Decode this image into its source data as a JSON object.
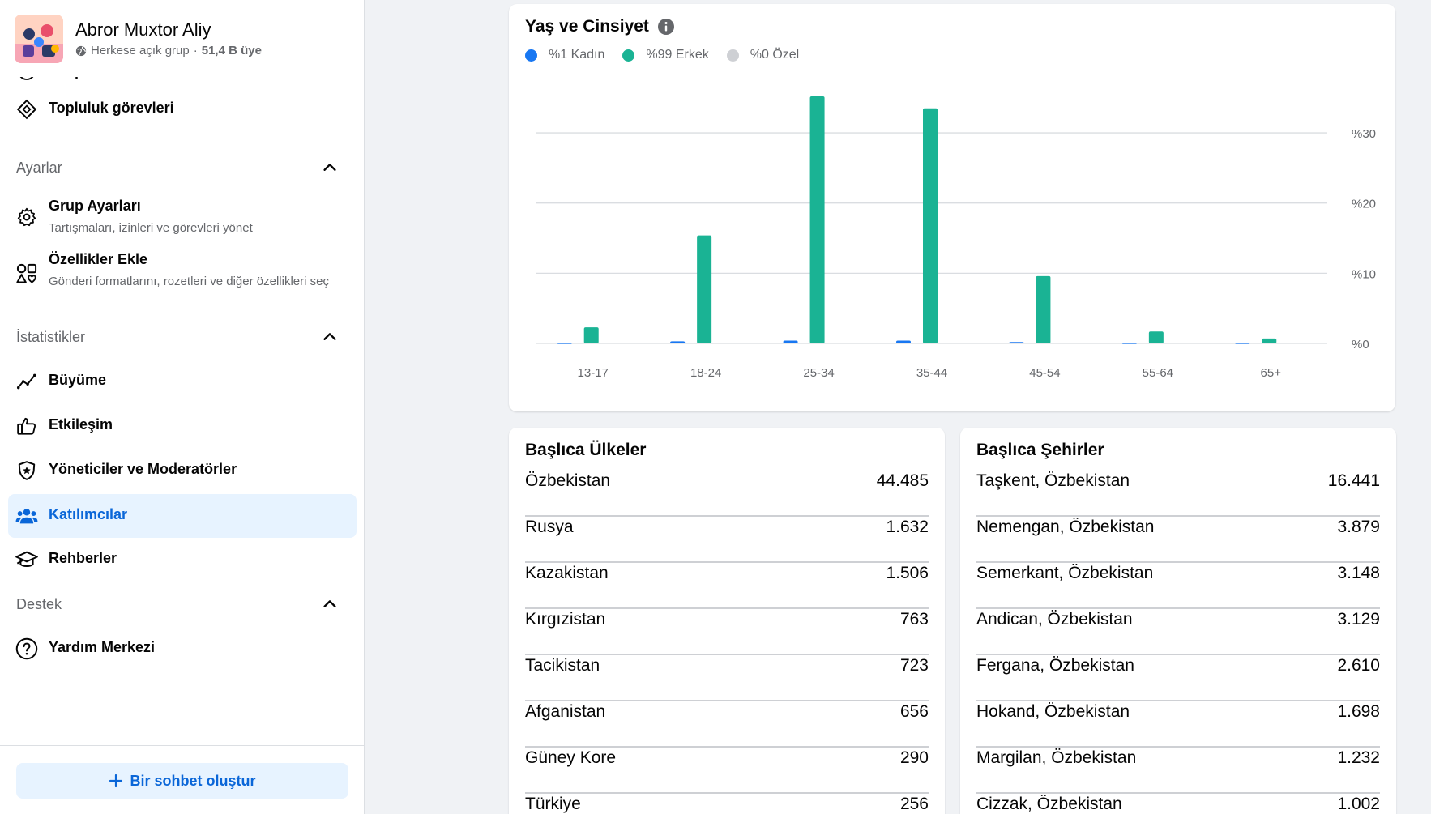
{
  "group": {
    "name": "Abror Muxtor Aliy",
    "privacy": "Herkese açık grup",
    "members": "51,4 B üye"
  },
  "nav": {
    "grup_durumu": "Grup durumu",
    "topluluk_gorevleri": "Topluluk görevleri",
    "ayarlar_section": "Ayarlar",
    "grup_ayarlari": {
      "label": "Grup Ayarları",
      "sub": "Tartışmaları, izinleri ve görevleri yönet"
    },
    "ozellikler_ekle": {
      "label": "Özellikler Ekle",
      "sub": "Gönderi formatlarını, rozetleri ve diğer özellikleri seç"
    },
    "istatistikler_section": "İstatistikler",
    "buyume": "Büyüme",
    "etkilesim": "Etkileşim",
    "yoneticiler": "Yöneticiler ve Moderatörler",
    "katilimcilar": "Katılımcılar",
    "rehberler": "Rehberler",
    "destek_section": "Destek",
    "yardim_merkezi": "Yardım Merkezi",
    "create_chat": "Bir sohbet oluştur"
  },
  "chart_data": {
    "type": "bar",
    "title": "Yaş ve Cinsiyet",
    "legend_placement": "top-left",
    "categories": [
      "13-17",
      "18-24",
      "25-34",
      "35-44",
      "45-54",
      "55-64",
      "65+"
    ],
    "series": [
      {
        "name": "%1 Kadın",
        "color": "#1877f2",
        "values": [
          0.1,
          0.3,
          0.4,
          0.4,
          0.2,
          0.1,
          0.1
        ]
      },
      {
        "name": "%99 Erkek",
        "color": "#1ab394",
        "values": [
          2.3,
          15.4,
          35.2,
          33.5,
          9.6,
          1.7,
          0.7
        ]
      },
      {
        "name": "%0 Özel",
        "color": "#ced0d4",
        "values": [
          0,
          0,
          0,
          0,
          0,
          0,
          0
        ]
      }
    ],
    "yticks": [
      "%0",
      "%10",
      "%20",
      "%30"
    ],
    "ytick_values": [
      0,
      10,
      20,
      30
    ],
    "ylim": [
      0,
      35.2
    ],
    "grid": true
  },
  "countries": {
    "title": "Başlıca Ülkeler",
    "rows": [
      {
        "name": "Özbekistan",
        "value": "44.485"
      },
      {
        "name": "Rusya",
        "value": "1.632"
      },
      {
        "name": "Kazakistan",
        "value": "1.506"
      },
      {
        "name": "Kırgızistan",
        "value": "763"
      },
      {
        "name": "Tacikistan",
        "value": "723"
      },
      {
        "name": "Afganistan",
        "value": "656"
      },
      {
        "name": "Güney Kore",
        "value": "290"
      },
      {
        "name": "Türkiye",
        "value": "256"
      }
    ]
  },
  "cities": {
    "title": "Başlıca Şehirler",
    "rows": [
      {
        "name": "Taşkent, Özbekistan",
        "value": "16.441"
      },
      {
        "name": "Nemengan, Özbekistan",
        "value": "3.879"
      },
      {
        "name": "Semerkant, Özbekistan",
        "value": "3.148"
      },
      {
        "name": "Andican, Özbekistan",
        "value": "3.129"
      },
      {
        "name": "Fergana, Özbekistan",
        "value": "2.610"
      },
      {
        "name": "Hokand, Özbekistan",
        "value": "1.698"
      },
      {
        "name": "Margilan, Özbekistan",
        "value": "1.232"
      },
      {
        "name": "Cizzak, Özbekistan",
        "value": "1.002"
      }
    ]
  }
}
